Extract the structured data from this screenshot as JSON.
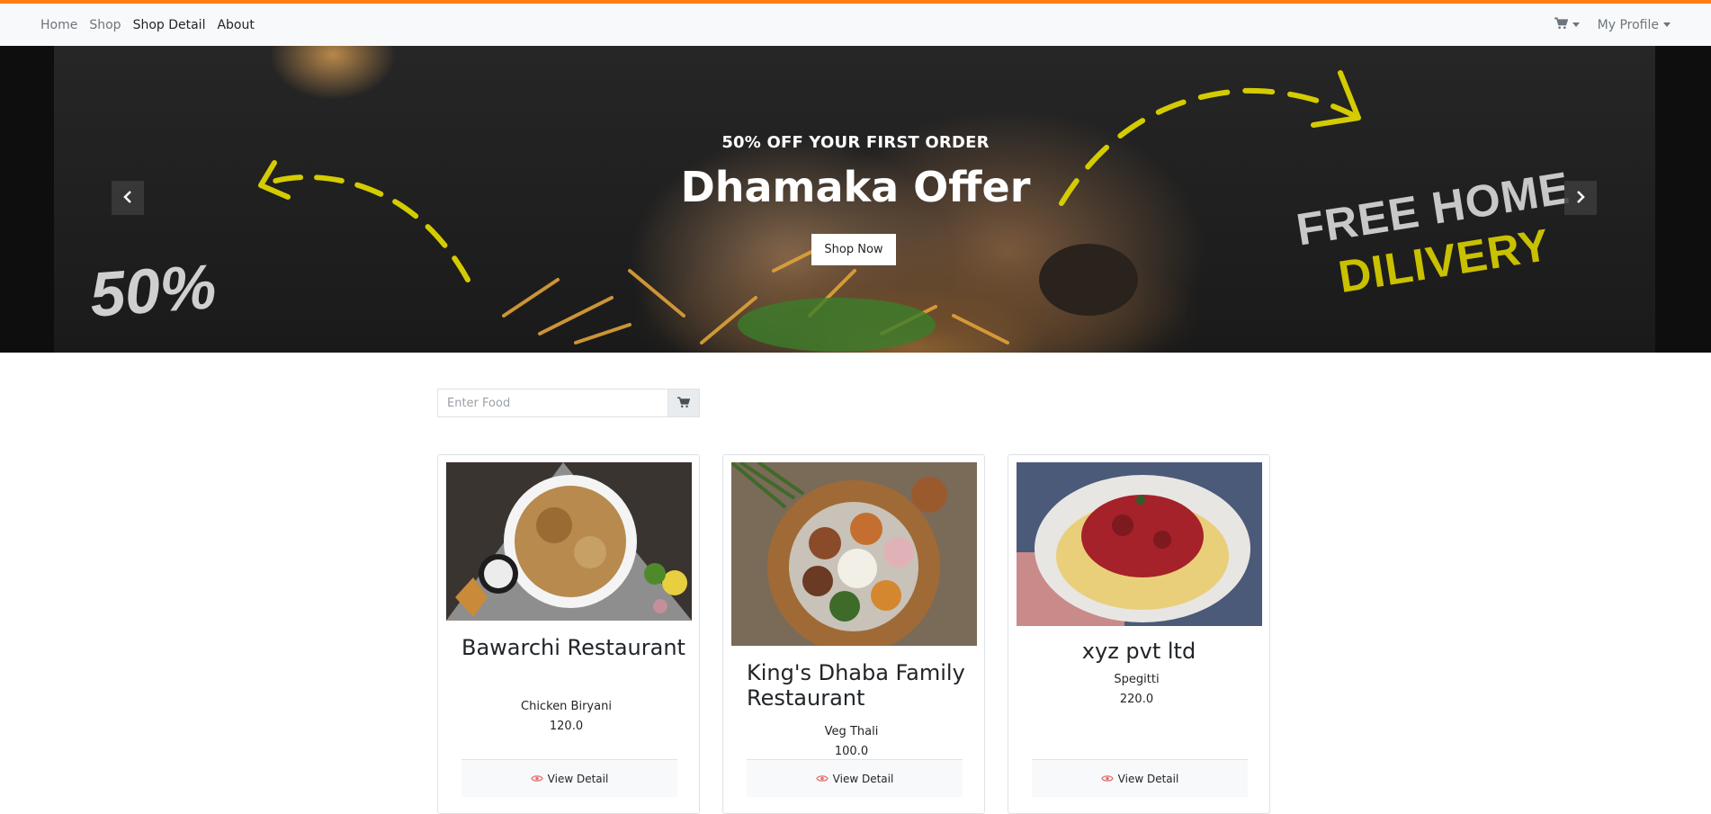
{
  "nav": {
    "links": [
      {
        "label": "Home"
      },
      {
        "label": "Shop"
      },
      {
        "label": "Shop Detail"
      },
      {
        "label": "About"
      }
    ],
    "cart_icon": "shopping-cart-icon",
    "profile_label": "My Profile"
  },
  "hero": {
    "subtitle": "50% OFF YOUR FIRST ORDER",
    "title": "Dhamaka Offer",
    "button": "Shop Now",
    "promo_left": "50%",
    "promo_right_line1": "FREE HOME",
    "promo_right_line2": "DILIVERY",
    "prev_icon": "chevron-left-icon",
    "next_icon": "chevron-right-icon"
  },
  "search": {
    "placeholder": "Enter Food",
    "button_icon": "shopping-cart-icon"
  },
  "cards": [
    {
      "restaurant": "Bawarchi Restaurant",
      "dish": "Chicken Biryani",
      "price": "120.0",
      "button": "View Detail"
    },
    {
      "restaurant": "King's Dhaba Family Restaurant",
      "dish": "Veg Thali",
      "price": "100.0",
      "button": "View Detail"
    },
    {
      "restaurant": "xyz pvt ltd",
      "dish": "Spegitti",
      "price": "220.0",
      "button": "View Detail"
    }
  ],
  "colors": {
    "accent_top_border": "#fd7e14",
    "navbar_bg": "#f8f9fa",
    "eye_icon": "#e57373",
    "promo_yellow": "#c9c000"
  }
}
